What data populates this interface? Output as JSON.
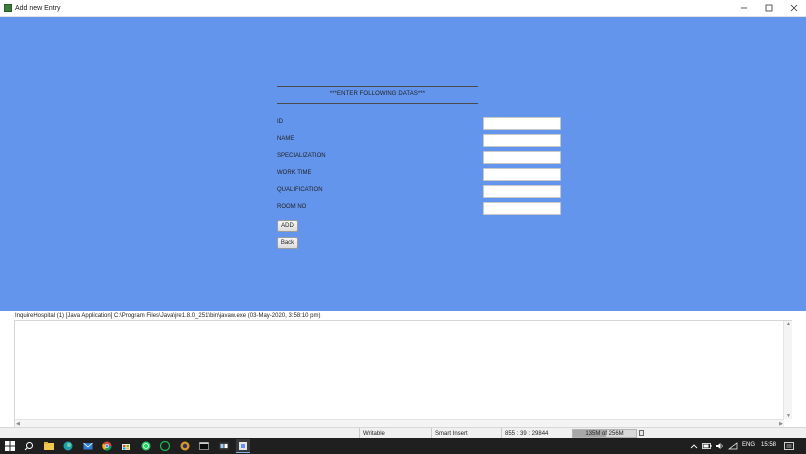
{
  "window": {
    "title": "Add new Entry"
  },
  "form": {
    "header": "***ENTER FOLLOWING DATAS***",
    "fields": [
      {
        "label": "ID",
        "value": ""
      },
      {
        "label": "NAME",
        "value": ""
      },
      {
        "label": "SPECIALIZATION",
        "value": ""
      },
      {
        "label": "WORK TIME",
        "value": ""
      },
      {
        "label": "QUALIFICATION",
        "value": ""
      },
      {
        "label": "ROOM NO",
        "value": ""
      }
    ],
    "add_label": "ADD",
    "back_label": "Back"
  },
  "console": {
    "header": "InquireHospital (1) [Java Application] C:\\Program Files\\Java\\jre1.8.0_251\\bin\\javaw.exe (03-May-2020, 3:58:10 pm)"
  },
  "status_bar": {
    "writable": "Writable",
    "insert_mode": "Smart Insert",
    "position": "855 : 39 : 29844",
    "heap": "135M of 256M",
    "heap_fraction": 0.53
  },
  "taskbar": {
    "language": "ENG",
    "time": "15:58",
    "icons": [
      "windows-start-icon",
      "search-icon",
      "file-explorer-icon",
      "edge-icon",
      "mail-icon",
      "chrome-icon",
      "store-icon",
      "whatsapp-icon",
      "spotify-icon",
      "eclipse-icon",
      "terminal-icon",
      "vscode-icon",
      "java-app-icon"
    ]
  },
  "colors": {
    "app_background": "#6495ED",
    "taskbar": "#1f1f1f"
  }
}
